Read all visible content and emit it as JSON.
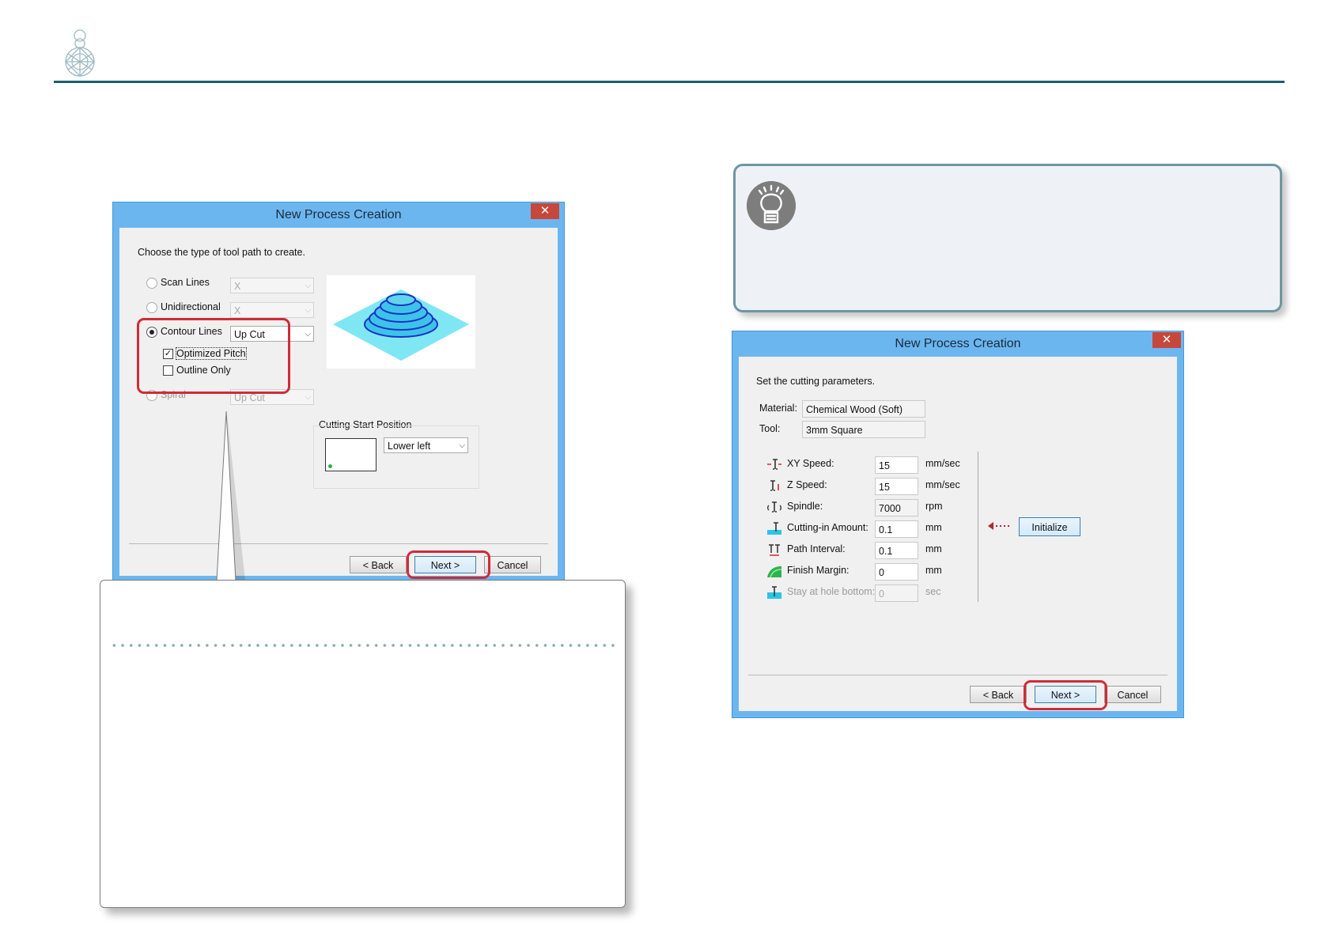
{
  "dialog1": {
    "title": "New Process Creation",
    "close_glyph": "✕",
    "prompt": "Choose the type of tool path to create.",
    "options": [
      {
        "label": "Scan Lines",
        "value": "X",
        "selected": false,
        "enabled": false
      },
      {
        "label": "Unidirectional",
        "value": "X",
        "selected": false,
        "enabled": false
      },
      {
        "label": "Contour Lines",
        "value": "Up Cut",
        "selected": true,
        "enabled": true
      },
      {
        "label": "Spiral",
        "value": "Up Cut",
        "selected": false,
        "enabled": false
      }
    ],
    "optimized_pitch": {
      "label": "Optimized Pitch",
      "checked": true
    },
    "outline_only": {
      "label": "Outline Only",
      "checked": false
    },
    "start_position": {
      "label": "Cutting Start Position",
      "value": "Lower left"
    },
    "buttons": {
      "back": "< Back",
      "next": "Next >",
      "cancel": "Cancel"
    }
  },
  "dialog2": {
    "title": "New Process Creation",
    "close_glyph": "✕",
    "prompt": "Set the cutting parameters.",
    "material": {
      "label": "Material:",
      "value": "Chemical Wood (Soft)"
    },
    "tool": {
      "label": "Tool:",
      "value": "3mm Square"
    },
    "params": [
      {
        "label": "XY Speed:",
        "value": "15",
        "unit": "mm/sec",
        "enabled": true,
        "icon": "xy-speed-icon"
      },
      {
        "label": "Z Speed:",
        "value": "15",
        "unit": "mm/sec",
        "enabled": true,
        "icon": "z-speed-icon"
      },
      {
        "label": "Spindle:",
        "value": "7000",
        "unit": "rpm",
        "enabled": true,
        "icon": "spindle-icon"
      },
      {
        "label": "Cutting-in Amount:",
        "value": "0.1",
        "unit": "mm",
        "enabled": true,
        "icon": "cutting-in-amount-icon"
      },
      {
        "label": "Path Interval:",
        "value": "0.1",
        "unit": "mm",
        "enabled": true,
        "icon": "path-interval-icon"
      },
      {
        "label": "Finish Margin:",
        "value": "0",
        "unit": "mm",
        "enabled": true,
        "icon": "finish-margin-icon"
      },
      {
        "label": "Stay at hole bottom:",
        "value": "0",
        "unit": "sec",
        "enabled": false,
        "icon": "stay-at-hole-bottom-icon"
      }
    ],
    "initialize_label": "Initialize",
    "buttons": {
      "back": "< Back",
      "next": "Next >",
      "cancel": "Cancel"
    }
  },
  "colors": {
    "accent": "#1f5e69",
    "highlight": "#d12b36",
    "titlebar": "#6cb6f0",
    "tip_border": "#6e96a1"
  },
  "icons": {
    "logo": "gemstone-logo-icon",
    "tip": "lightbulb-icon",
    "close": "close-icon"
  }
}
